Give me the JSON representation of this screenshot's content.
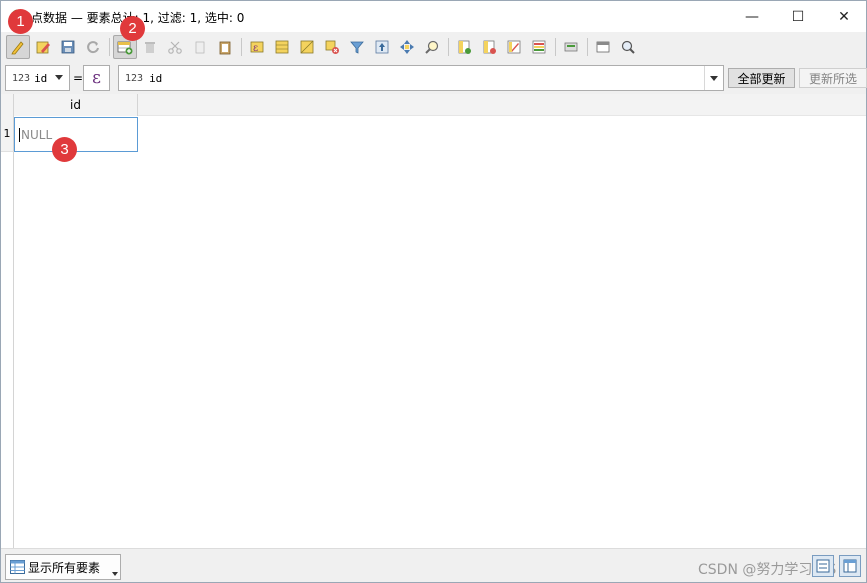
{
  "window": {
    "title": "点数据 — 要素总计: 1, 过滤: 1, 选中: 0",
    "minimize_glyph": "—",
    "maximize_glyph": "☐",
    "close_glyph": "✕"
  },
  "toolbar": {
    "buttons": [
      "toggle-editing-icon",
      "multi-edit-icon",
      "save-edits-icon",
      "reload-icon",
      "add-feature-icon",
      "delete-feature-icon",
      "cut-icon",
      "copy-icon",
      "paste-icon",
      "select-expression-icon",
      "select-all-icon",
      "invert-selection-icon",
      "deselect-all-icon",
      "filter-icon",
      "move-selection-top-icon",
      "pan-to-selected-icon",
      "zoom-to-selected-icon",
      "new-field-icon",
      "delete-field-icon",
      "field-calculator-icon",
      "conditional-formatting-icon",
      "actions-icon",
      "dock-icon",
      "zoom-map-icon"
    ]
  },
  "expression_bar": {
    "field_type": "123",
    "field_name": "id",
    "equals": "=",
    "epsilon": "ε",
    "expression_type": "123",
    "expression_value": "id",
    "update_all_label": "全部更新",
    "update_selected_label": "更新所选"
  },
  "table": {
    "columns": [
      "id"
    ],
    "rows": [
      {
        "row_number": "1",
        "id": "NULL"
      }
    ]
  },
  "statusbar": {
    "show_all_label": "显示所有要素",
    "watermark": "CSDN @努力学习GIS"
  },
  "annotations": {
    "marker_1": "1",
    "marker_2": "2",
    "marker_3": "3"
  },
  "colors": {
    "marker": "#e0393b",
    "edit_border": "#5b9bd5",
    "qgis_green": "#589632"
  }
}
